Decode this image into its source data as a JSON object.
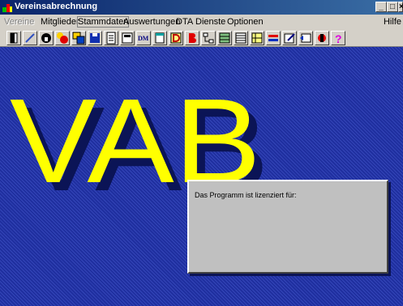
{
  "window": {
    "title": "Vereinsabrechnung",
    "controls": [
      "_",
      "□",
      "×"
    ]
  },
  "menu": {
    "items": [
      {
        "label": "Vereine",
        "disabled": true
      },
      {
        "label": "Mitglieder",
        "disabled": false
      },
      {
        "label": "Stammdaten",
        "disabled": false
      },
      {
        "label": "Auswertungen",
        "disabled": false
      },
      {
        "label": "DTA",
        "disabled": false
      },
      {
        "label": "Dienste",
        "disabled": false
      },
      {
        "label": "Optionen",
        "disabled": false
      }
    ],
    "help": "Hilfe"
  },
  "toolbar": {
    "buttons": [
      "exit-door-icon",
      "pen-icon",
      "lock-icon",
      "balls-icon",
      "windows-icon",
      "save-disk-icon",
      "document-icon",
      "calculator-icon",
      "dm-currency-icon",
      "notepad-icon",
      "d-table-icon",
      "letter-b-icon",
      "tree-chart-icon",
      "sheet-icon",
      "list-icon",
      "grid-icon",
      "transfer-arrows-icon",
      "edit-icon",
      "bank-transfer-icon",
      "tools-icon",
      "help-icon"
    ],
    "dm_text": "DM"
  },
  "logo": {
    "text": "VAB",
    "color": "#ffff00",
    "shadow": "#0b1456"
  },
  "license": {
    "label": "Das Programm ist lizenziert für:"
  },
  "colors": {
    "desktop": "#1f2f9f",
    "titlebar": "#0a246a"
  }
}
